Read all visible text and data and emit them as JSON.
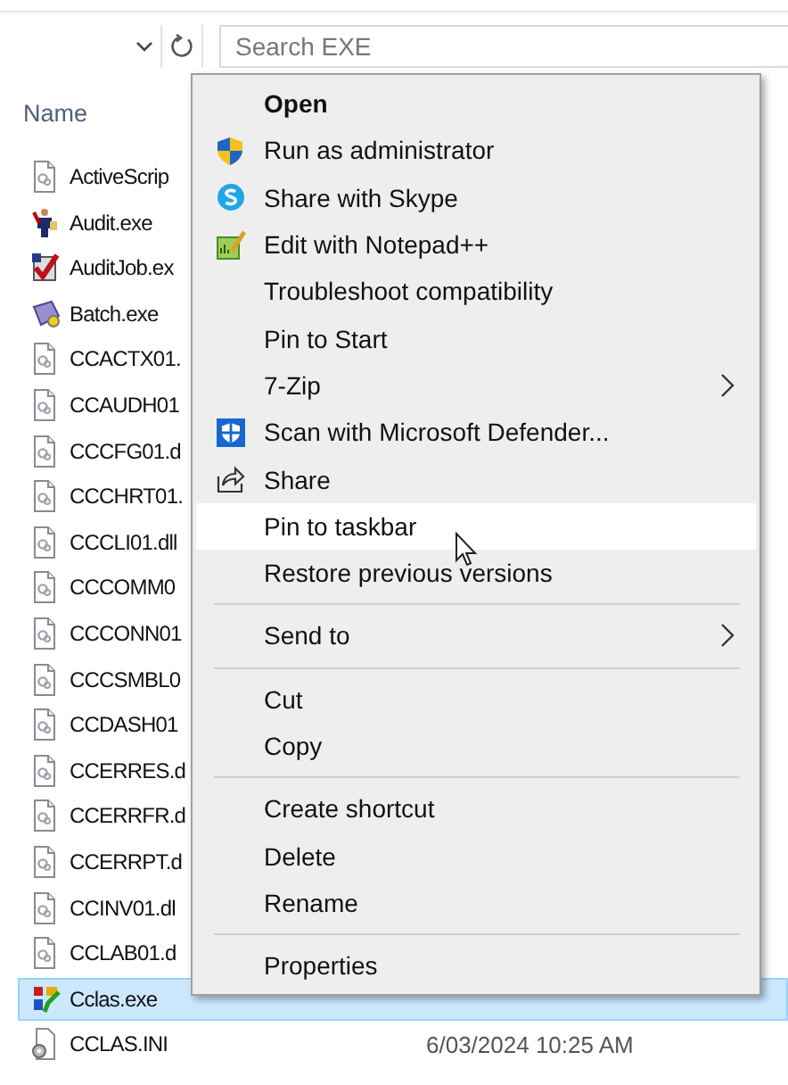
{
  "address_bar": {
    "placeholder": "Search EXE"
  },
  "file_list": {
    "column": "Name",
    "rows": [
      {
        "name": "ActiveScrip",
        "selected": false
      },
      {
        "name": "Audit.exe",
        "selected": false
      },
      {
        "name": "AuditJob.ex",
        "selected": false
      },
      {
        "name": "Batch.exe",
        "selected": false
      },
      {
        "name": "CCACTX01.",
        "selected": false
      },
      {
        "name": "CCAUDH01",
        "selected": false
      },
      {
        "name": "CCCFG01.d",
        "selected": false
      },
      {
        "name": "CCCHRT01.",
        "selected": false
      },
      {
        "name": "CCCLI01.dll",
        "selected": false
      },
      {
        "name": "CCCOMM0",
        "selected": false
      },
      {
        "name": "CCCONN01",
        "selected": false
      },
      {
        "name": "CCCSMBL0",
        "selected": false
      },
      {
        "name": "CCDASH01",
        "selected": false
      },
      {
        "name": "CCERRES.d",
        "selected": false
      },
      {
        "name": "CCERRFR.d",
        "selected": false
      },
      {
        "name": "CCERRPT.d",
        "selected": false
      },
      {
        "name": "CCINV01.dl",
        "selected": false
      },
      {
        "name": "CCLAB01.d",
        "selected": false
      },
      {
        "name": "Cclas.exe",
        "selected": true
      },
      {
        "name": "CCLAS.INI",
        "date": "6/03/2024 10:25 AM",
        "selected": false
      }
    ]
  },
  "context_menu": {
    "items": [
      {
        "kind": "item",
        "label": "Open",
        "default": true,
        "selected": false
      },
      {
        "kind": "item",
        "label": "Run as administrator",
        "default": false,
        "selected": false
      },
      {
        "kind": "item",
        "label": "Share with Skype",
        "default": false,
        "selected": false
      },
      {
        "kind": "item",
        "label": "Edit with Notepad++",
        "default": false,
        "selected": false
      },
      {
        "kind": "item",
        "label": "Troubleshoot compatibility",
        "default": false,
        "selected": false
      },
      {
        "kind": "item",
        "label": "Pin to Start",
        "default": false,
        "selected": false
      },
      {
        "kind": "submenu",
        "label": "7-Zip",
        "default": false,
        "selected": false
      },
      {
        "kind": "item",
        "label": "Scan with Microsoft Defender...",
        "default": false,
        "selected": false
      },
      {
        "kind": "item",
        "label": "Share",
        "default": false,
        "selected": false
      },
      {
        "kind": "item",
        "label": "Pin to taskbar",
        "default": false,
        "selected": true
      },
      {
        "kind": "item",
        "label": "Restore previous versions",
        "default": false,
        "selected": false
      },
      {
        "kind": "separator"
      },
      {
        "kind": "submenu",
        "label": "Send to",
        "default": false,
        "selected": false
      },
      {
        "kind": "separator"
      },
      {
        "kind": "item",
        "label": "Cut",
        "default": false,
        "selected": false
      },
      {
        "kind": "item",
        "label": "Copy",
        "default": false,
        "selected": false
      },
      {
        "kind": "separator"
      },
      {
        "kind": "item",
        "label": "Create shortcut",
        "default": false,
        "selected": false
      },
      {
        "kind": "item",
        "label": "Delete",
        "default": false,
        "selected": false
      },
      {
        "kind": "item",
        "label": "Rename",
        "default": false,
        "selected": false
      },
      {
        "kind": "separator"
      },
      {
        "kind": "item",
        "label": "Properties",
        "default": false,
        "selected": false
      }
    ]
  }
}
